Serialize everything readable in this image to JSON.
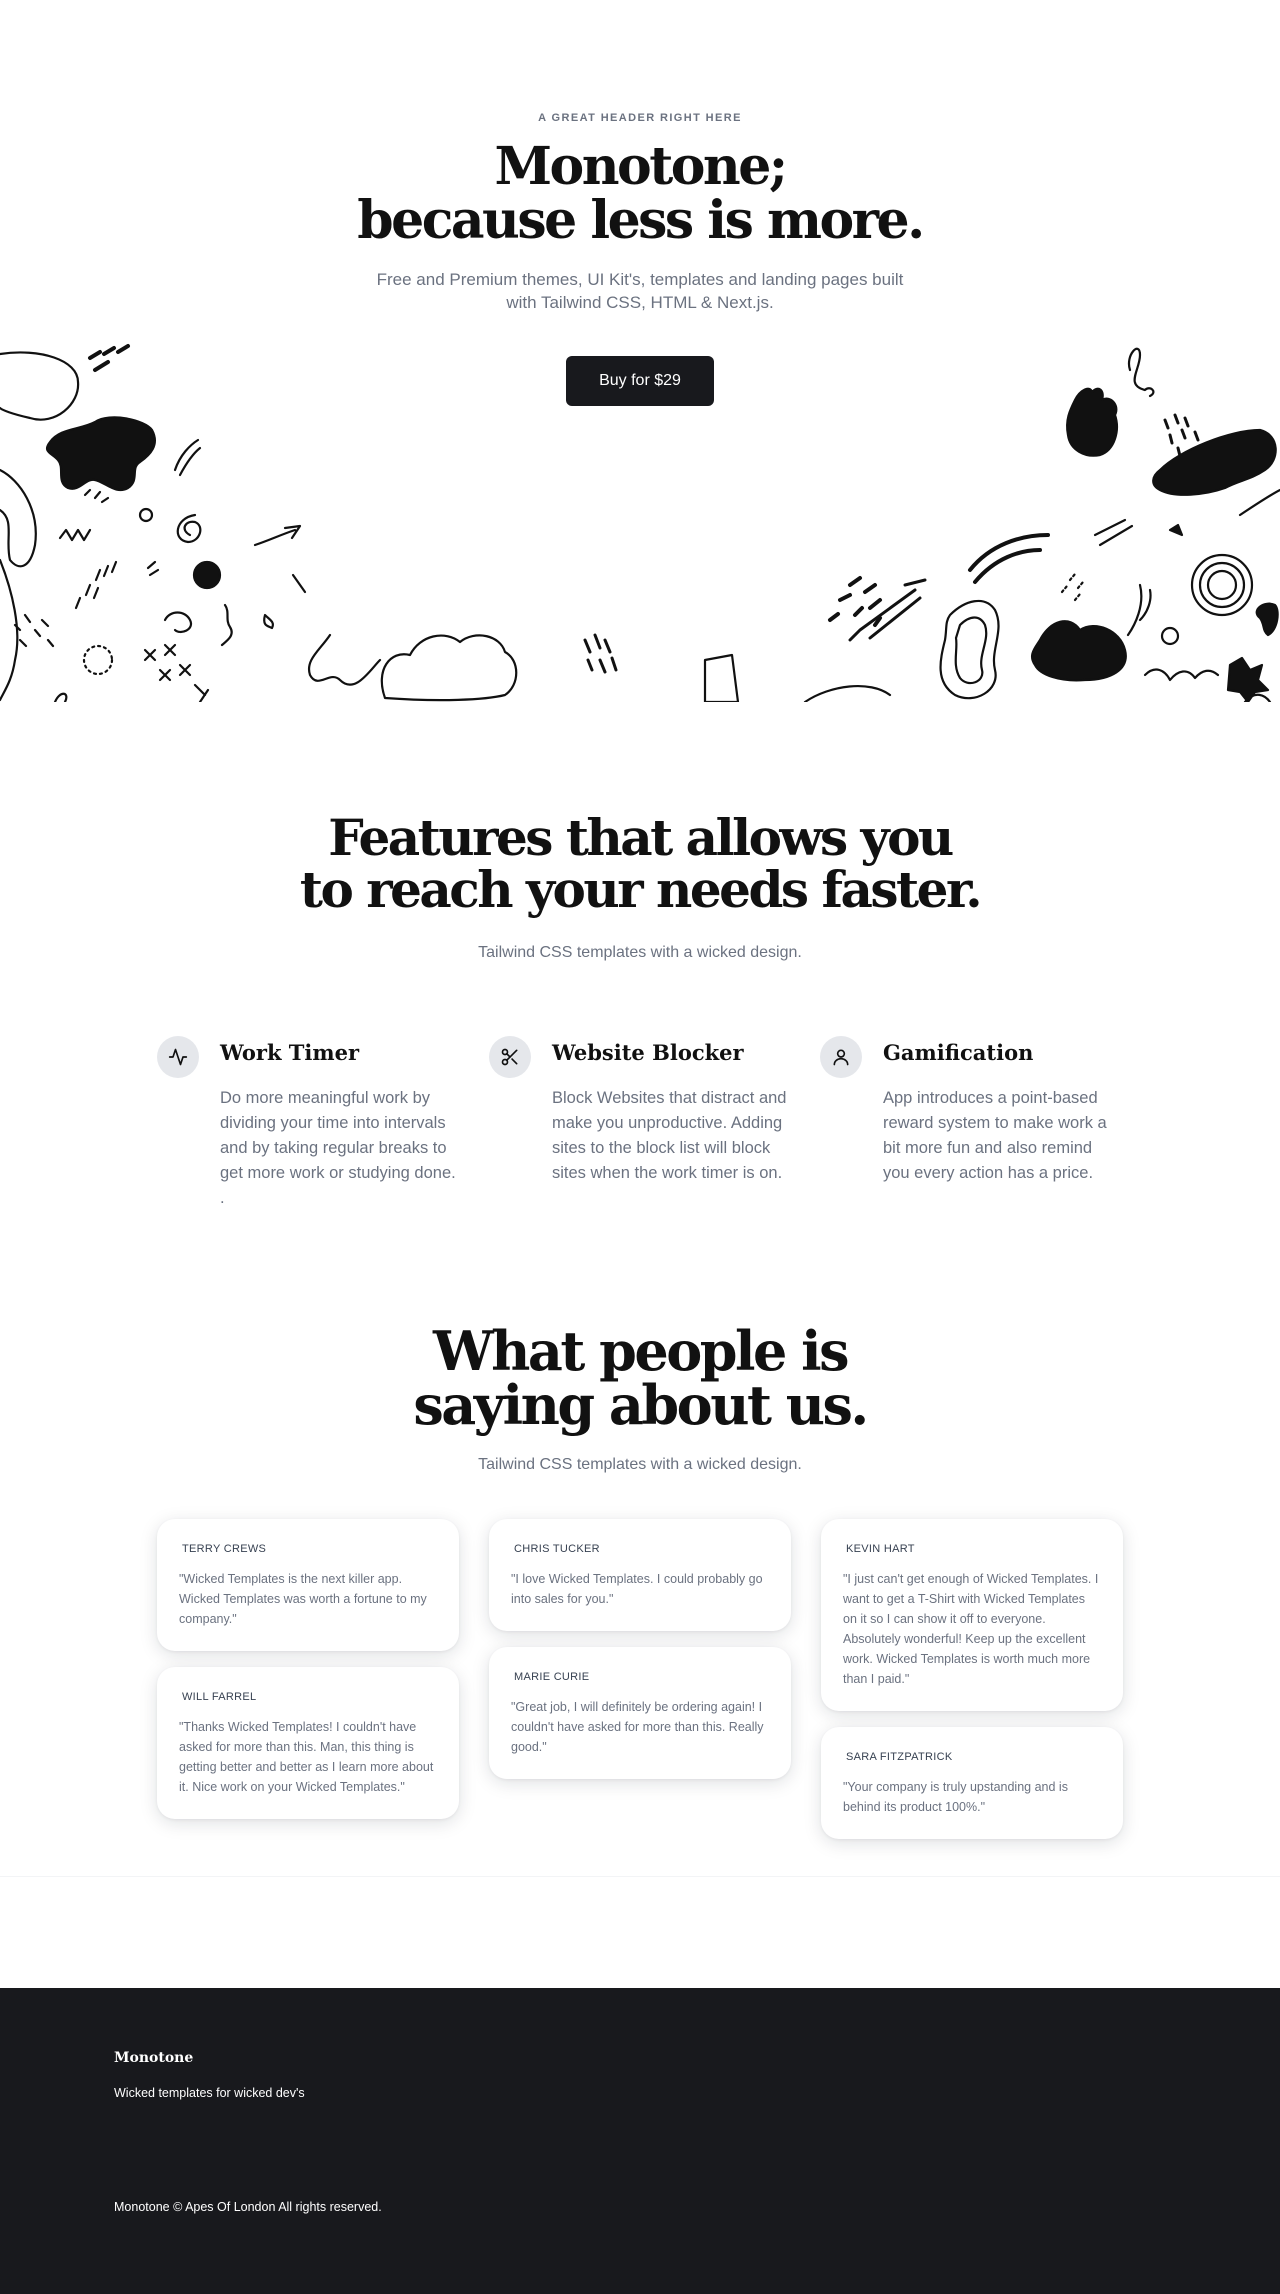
{
  "hero": {
    "eyebrow": "A GREAT HEADER RIGHT HERE",
    "title_line1": "Monotone;",
    "title_line2": "because less is more.",
    "subtitle": "Free and Premium themes, UI Kit's, templates and landing pages built with Tailwind CSS, HTML & Next.js.",
    "cta_label": "Buy for $29"
  },
  "features": {
    "title_line1": "Features that allows you",
    "title_line2": "to reach your needs faster.",
    "subtitle": "Tailwind CSS templates with a wicked design.",
    "items": [
      {
        "icon": "activity-icon",
        "title": "Work Timer",
        "text": "Do more meaningful work by dividing your time into intervals and by taking regular breaks to get more work or studying done. ."
      },
      {
        "icon": "scissors-icon",
        "title": "Website Blocker",
        "text": "Block Websites that distract and make you unproductive. Adding sites to the block list will block sites when the work timer is on."
      },
      {
        "icon": "user-icon",
        "title": "Gamification",
        "text": "App introduces a point-based reward system to make work a bit more fun and also remind you every action has a price."
      }
    ]
  },
  "testimonials": {
    "title_line1": "What people is",
    "title_line2": "saying about us.",
    "subtitle": "Tailwind CSS templates with a wicked design.",
    "cards": [
      {
        "name": "TERRY CREWS",
        "quote": "\"Wicked Templates is the next killer app. Wicked Templates was worth a fortune to my company.\""
      },
      {
        "name": "WILL FARREL",
        "quote": "\"Thanks Wicked Templates! I couldn't have asked for more than this. Man, this thing is getting better and better as I learn more about it. Nice work on your Wicked Templates.\""
      },
      {
        "name": "CHRIS TUCKER",
        "quote": "\"I love Wicked Templates. I could probably go into sales for you.\""
      },
      {
        "name": "MARIE CURIE",
        "quote": "\"Great job, I will definitely be ordering again! I couldn't have asked for more than this. Really good.\""
      },
      {
        "name": "KEVIN HART",
        "quote": "\"I just can't get enough of Wicked Templates. I want to get a T-Shirt with Wicked Templates on it so I can show it off to everyone. Absolutely wonderful! Keep up the excellent work. Wicked Templates is worth much more than I paid.\""
      },
      {
        "name": "SARA FITZPATRICK",
        "quote": "\"Your company is truly upstanding and is behind its product 100%.\""
      }
    ]
  },
  "footer": {
    "brand": "Monotone",
    "tagline": "Wicked templates for wicked dev's",
    "copyright": "Monotone © Apes Of London All rights reserved."
  },
  "colors": {
    "ink": "#111111",
    "muted": "#6b7280",
    "button": "#18191d",
    "footer_bg": "#18191d",
    "icon_bg": "#e5e7eb"
  }
}
